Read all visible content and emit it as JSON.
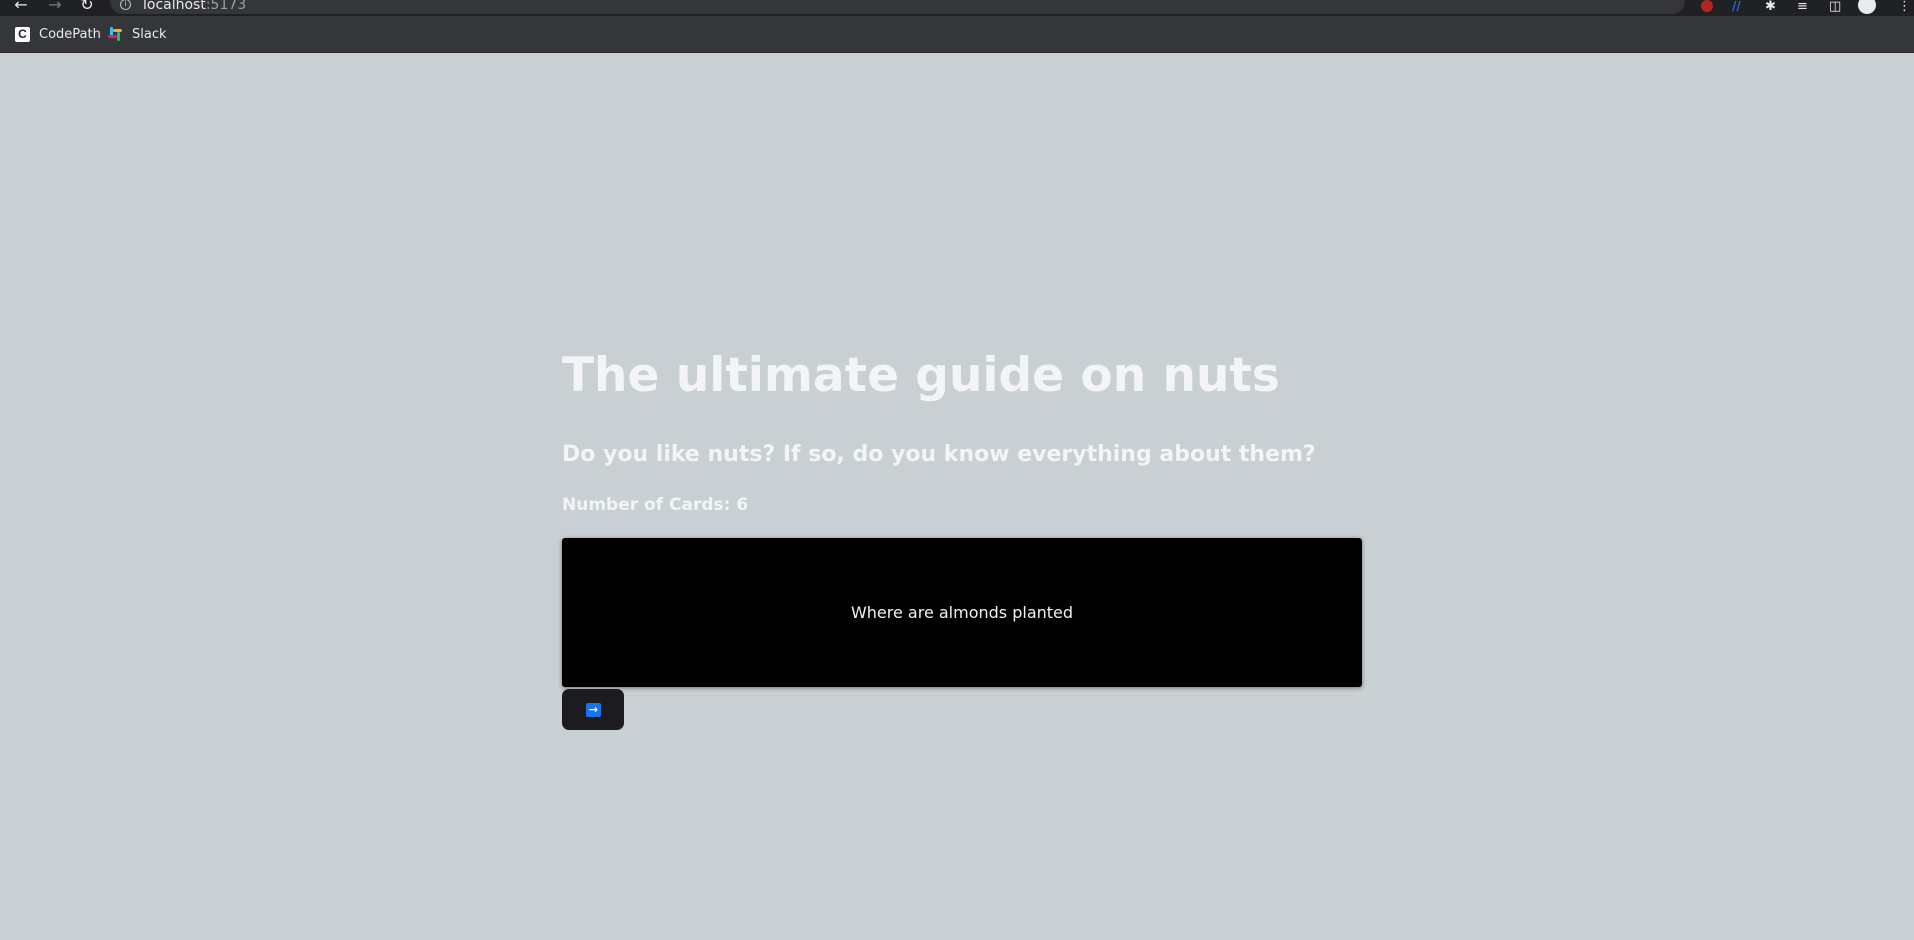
{
  "browser": {
    "url_host": "localhost",
    "url_port": ":5173",
    "bookmarks": [
      {
        "label": "CodePath"
      },
      {
        "label": "Slack"
      }
    ]
  },
  "page": {
    "title": "The ultimate guide on nuts",
    "subtitle": "Do you like nuts? If so, do you know everything about them?",
    "card_count_label": "Number of Cards: 6",
    "card_text": "Where are almonds planted",
    "next_button_icon": "arrow-right-icon"
  }
}
